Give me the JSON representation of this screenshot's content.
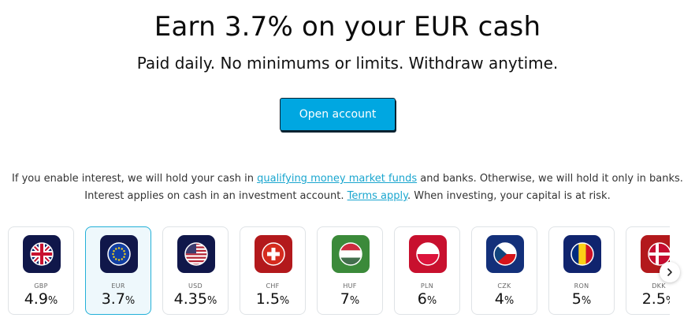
{
  "hero": {
    "title": "Earn 3.7% on your EUR cash",
    "subtitle": "Paid daily. No minimums or limits. Withdraw anytime.",
    "cta_label": "Open account"
  },
  "disclaimer": {
    "line1_before": "If you enable interest, we will hold your cash in ",
    "line1_link": "qualifying money market funds",
    "line1_after": " and banks. Otherwise, we will hold it only in banks.",
    "line2_before": "Interest applies on cash in an investment account. ",
    "line2_link": "Terms apply",
    "line2_after": ". When investing, your capital is at risk."
  },
  "currencies": [
    {
      "code": "GBP",
      "rate": "4.9",
      "flag": "uk-flag-icon"
    },
    {
      "code": "EUR",
      "rate": "3.7",
      "flag": "eu-flag-icon",
      "selected": true
    },
    {
      "code": "USD",
      "rate": "4.35",
      "flag": "us-flag-icon"
    },
    {
      "code": "CHF",
      "rate": "1.5",
      "flag": "swiss-flag-icon"
    },
    {
      "code": "HUF",
      "rate": "7",
      "flag": "hungary-flag-icon"
    },
    {
      "code": "PLN",
      "rate": "6",
      "flag": "poland-flag-icon"
    },
    {
      "code": "CZK",
      "rate": "4",
      "flag": "czech-flag-icon"
    },
    {
      "code": "RON",
      "rate": "5",
      "flag": "romania-flag-icon"
    },
    {
      "code": "DKK",
      "rate": "2.5",
      "flag": "denmark-flag-icon"
    }
  ],
  "percent_sign": "%",
  "colors": {
    "accent": "#00a7e1",
    "link": "#1aa6cf",
    "selected_border": "#23b0d8"
  }
}
